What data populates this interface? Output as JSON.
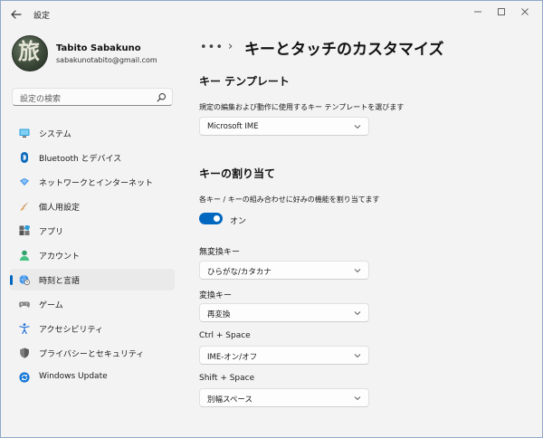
{
  "window": {
    "title": "設定"
  },
  "profile": {
    "name": "Tabito Sabakuno",
    "email": "sabakunotabito@gmail.com",
    "avatar_glyph": "旅"
  },
  "search": {
    "placeholder": "設定の検索"
  },
  "sidebar": {
    "items": [
      {
        "label": "システム",
        "icon": "monitor-icon",
        "active": false
      },
      {
        "label": "Bluetooth とデバイス",
        "icon": "bluetooth-icon",
        "active": false
      },
      {
        "label": "ネットワークとインターネット",
        "icon": "network-icon",
        "active": false
      },
      {
        "label": "個人用設定",
        "icon": "brush-icon",
        "active": false
      },
      {
        "label": "アプリ",
        "icon": "apps-icon",
        "active": false
      },
      {
        "label": "アカウント",
        "icon": "person-icon",
        "active": false
      },
      {
        "label": "時刻と言語",
        "icon": "globe-clock-icon",
        "active": true
      },
      {
        "label": "ゲーム",
        "icon": "gamepad-icon",
        "active": false
      },
      {
        "label": "アクセシビリティ",
        "icon": "accessibility-icon",
        "active": false
      },
      {
        "label": "プライバシーとセキュリティ",
        "icon": "shield-icon",
        "active": false
      },
      {
        "label": "Windows Update",
        "icon": "update-icon",
        "active": false
      }
    ]
  },
  "breadcrumb": {
    "more": "•••",
    "separator": "›",
    "title": "キーとタッチのカスタマイズ"
  },
  "key_template": {
    "heading": "キー テンプレート",
    "description": "規定の編集および動作に使用するキー テンプレートを選びます",
    "selected": "Microsoft IME"
  },
  "key_assign": {
    "heading": "キーの割り当て",
    "description": "各キー / キーの組み合わせに好みの機能を割り当てます",
    "toggle_on": true,
    "toggle_label": "オン",
    "fields": [
      {
        "label": "無変換キー",
        "value": "ひらがな/カタカナ"
      },
      {
        "label": "変換キー",
        "value": "再変換"
      },
      {
        "label": "Ctrl + Space",
        "value": "IME-オン/オフ"
      },
      {
        "label": "Shift + Space",
        "value": "別幅スペース"
      }
    ]
  },
  "colors": {
    "accent": "#0067c0",
    "background": "#f3f3f3"
  }
}
